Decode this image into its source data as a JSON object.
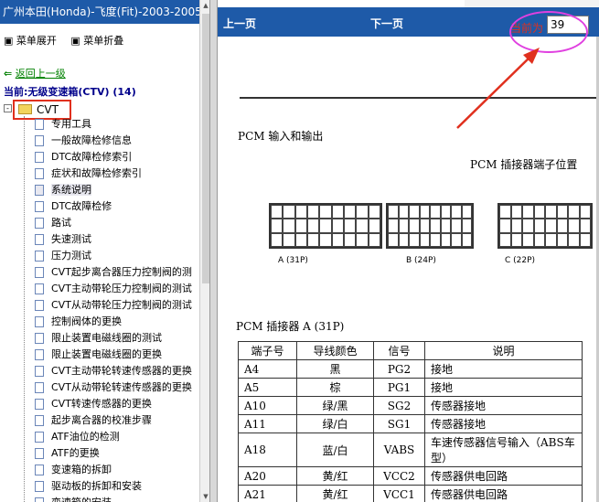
{
  "left_panel": {
    "title": "广州本田(Honda)-飞度(Fit)-2003-2005",
    "menu_expand": "菜单展开",
    "menu_collapse": "菜单折叠",
    "back": "返回上一级",
    "current": "当前:无级变速箱(CTV) (14)",
    "node": "CVT",
    "items": [
      "专用工具",
      "一般故障检修信息",
      "DTC故障检修索引",
      "症状和故障检修索引",
      "系统说明",
      "DTC故障检修",
      "路试",
      "失速测试",
      "压力测试",
      "CVT起步离合器压力控制阀的测",
      "CVT主动带轮压力控制阀的测试",
      "CVT从动带轮压力控制阀的测试",
      "控制阀体的更换",
      "限止装置电磁线圈的测试",
      "限止装置电磁线圈的更换",
      "CVT主动带轮转速传感器的更换",
      "CVT从动带轮转速传感器的更换",
      "CVT转速传感器的更换",
      "起步离合器的校准步骤",
      "ATF油位的检测",
      "ATF的更换",
      "变速箱的拆卸",
      "驱动板的拆卸和安装",
      "变速箱的安装"
    ],
    "selected_index": 4
  },
  "toolbar": {
    "prev": "上一页",
    "next": "下一页",
    "page_label": "当前为",
    "page_value": "39"
  },
  "document": {
    "section_title": "PCM 输入和输出",
    "connector_title": "PCM 插接器端子位置",
    "connectors": [
      "A (31P)",
      "B (24P)",
      "C (22P)"
    ],
    "table_title": "PCM 插接器 A (31P)",
    "table_headers": [
      "端子号",
      "导线颜色",
      "信号",
      "说明"
    ],
    "table_rows": [
      [
        "A4",
        "黑",
        "PG2",
        "接地"
      ],
      [
        "A5",
        "棕",
        "PG1",
        "接地"
      ],
      [
        "A10",
        "绿/黑",
        "SG2",
        "传感器接地"
      ],
      [
        "A11",
        "绿/白",
        "SG1",
        "传感器接地"
      ],
      [
        "A18",
        "蓝/白",
        "VABS",
        "车速传感器信号输入（ABS车型）"
      ],
      [
        "A20",
        "黄/红",
        "VCC2",
        "传感器供电回路"
      ],
      [
        "A21",
        "黄/红",
        "VCC1",
        "传感器供电回路"
      ]
    ]
  },
  "colors": {
    "title_bar": "#1e5aa8",
    "annotation_red": "#e0301e",
    "annotation_magenta": "#e040e0"
  }
}
